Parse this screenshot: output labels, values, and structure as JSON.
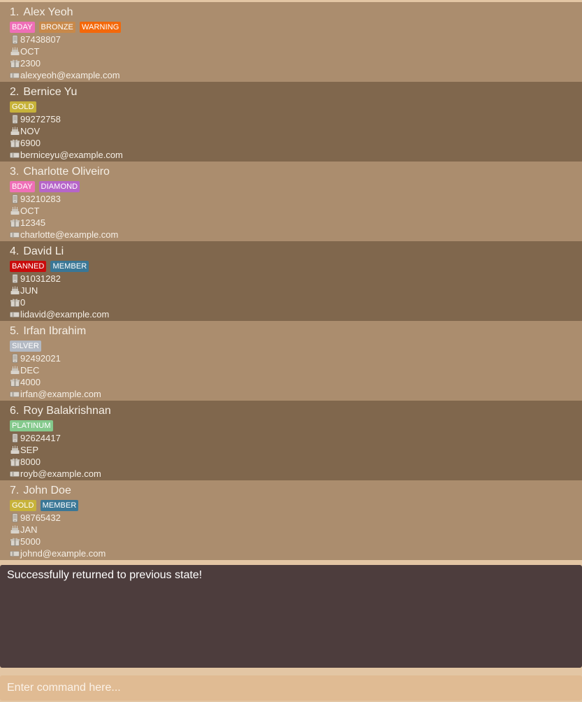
{
  "colors": {
    "background": "#e3c6a4",
    "card_odd": "#ab8d6e",
    "card_even": "#80674d",
    "result_box": "#4d3d3d",
    "command_box": "#e0bb93"
  },
  "tag_colors": {
    "BDAY": "#ef6fb7",
    "BRONZE": "#c8894a",
    "WARNING": "#f4680a",
    "GOLD": "#c7b23a",
    "DIAMOND": "#b665c9",
    "BANNED": "#c90c0c",
    "MEMBER": "#3a7796",
    "SILVER": "#b3b9c3",
    "PLATINUM": "#84c98c"
  },
  "icons": {
    "phone": "phone-icon",
    "birthday": "birthday-cake-icon",
    "points": "gift-points-icon",
    "email": "email-icon"
  },
  "persons": [
    {
      "index": "1.",
      "name": "Alex Yeoh",
      "tags": [
        "BDAY",
        "BRONZE",
        "WARNING"
      ],
      "phone": "87438807",
      "birthday": "OCT",
      "points": "2300",
      "email": "alexyeoh@example.com"
    },
    {
      "index": "2.",
      "name": "Bernice Yu",
      "tags": [
        "GOLD"
      ],
      "phone": "99272758",
      "birthday": "NOV",
      "points": "6900",
      "email": "berniceyu@example.com"
    },
    {
      "index": "3.",
      "name": "Charlotte Oliveiro",
      "tags": [
        "BDAY",
        "DIAMOND"
      ],
      "phone": "93210283",
      "birthday": "OCT",
      "points": "12345",
      "email": "charlotte@example.com"
    },
    {
      "index": "4.",
      "name": "David Li",
      "tags": [
        "BANNED",
        "MEMBER"
      ],
      "phone": "91031282",
      "birthday": "JUN",
      "points": "0",
      "email": "lidavid@example.com"
    },
    {
      "index": "5.",
      "name": "Irfan Ibrahim",
      "tags": [
        "SILVER"
      ],
      "phone": "92492021",
      "birthday": "DEC",
      "points": "4000",
      "email": "irfan@example.com"
    },
    {
      "index": "6.",
      "name": "Roy Balakrishnan",
      "tags": [
        "PLATINUM"
      ],
      "phone": "92624417",
      "birthday": "SEP",
      "points": "8000",
      "email": "royb@example.com"
    },
    {
      "index": "7.",
      "name": "John Doe",
      "tags": [
        "GOLD",
        "MEMBER"
      ],
      "phone": "98765432",
      "birthday": "JAN",
      "points": "5000",
      "email": "johnd@example.com"
    }
  ],
  "result": {
    "message": "Successfully returned to previous state!"
  },
  "command": {
    "value": "",
    "placeholder": "Enter command here..."
  }
}
